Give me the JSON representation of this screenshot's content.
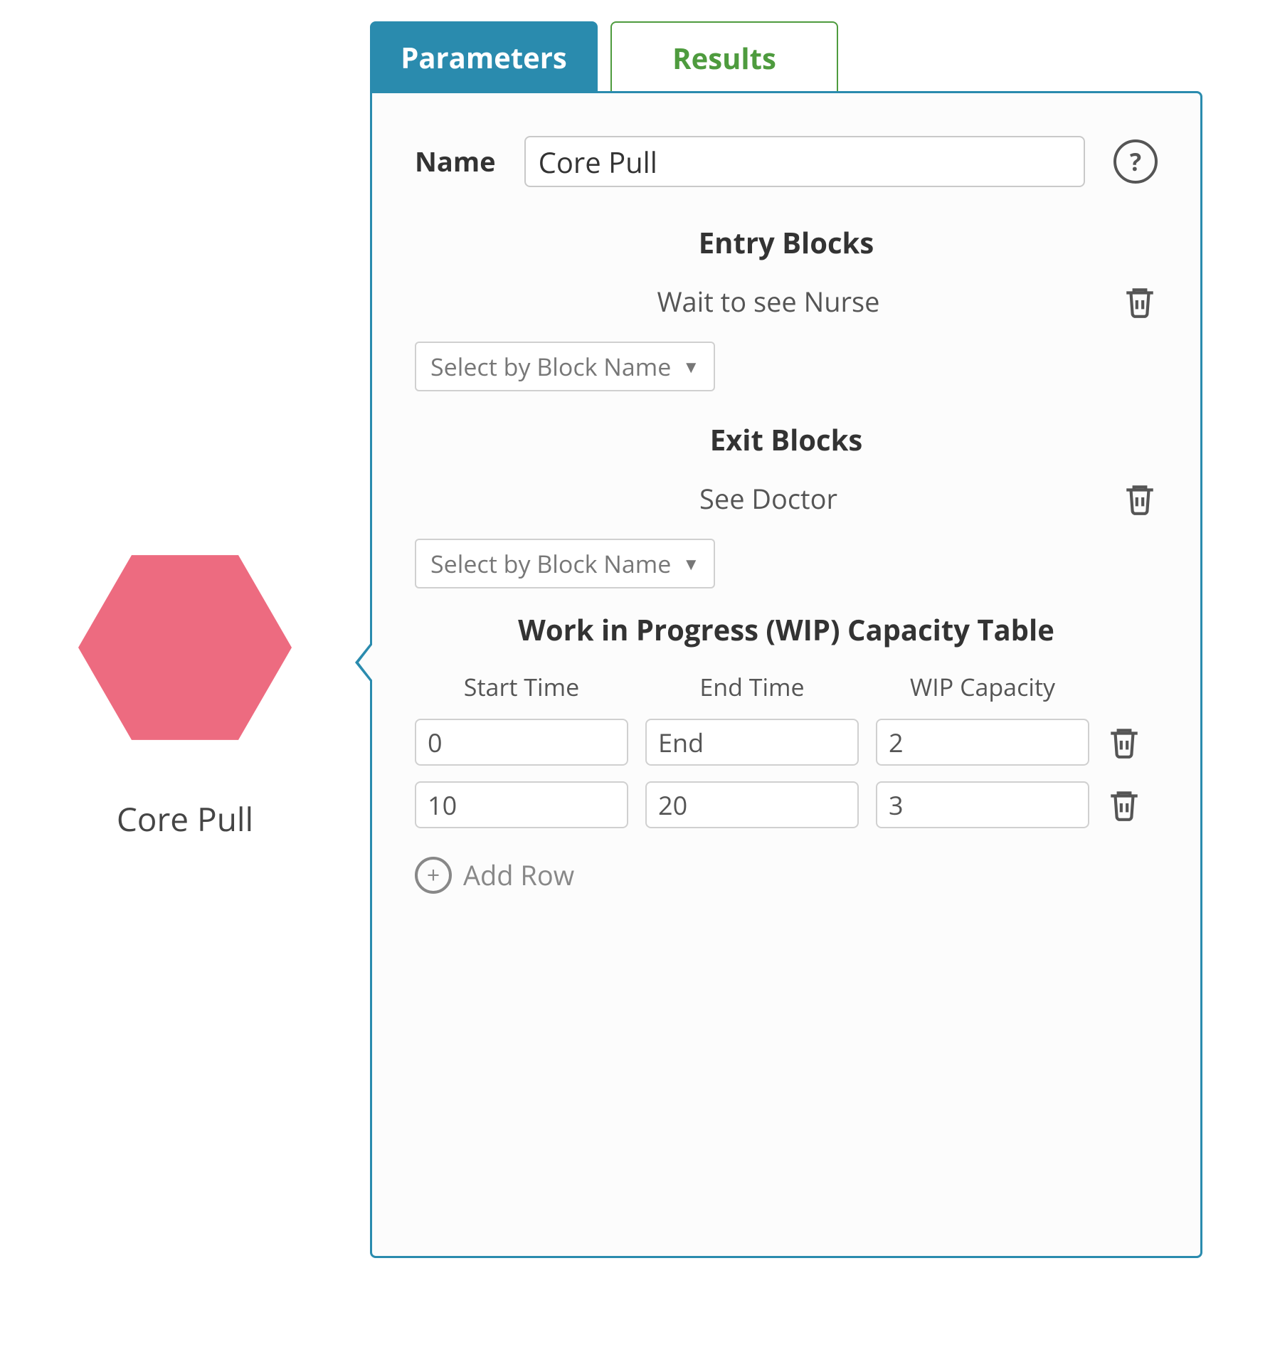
{
  "node": {
    "label": "Core Pull"
  },
  "tabs": {
    "parameters": "Parameters",
    "results": "Results"
  },
  "panel": {
    "name_label": "Name",
    "name_value": "Core Pull",
    "entry_blocks_title": "Entry Blocks",
    "entry_blocks": [
      {
        "label": "Wait to see Nurse"
      }
    ],
    "exit_blocks_title": "Exit Blocks",
    "exit_blocks": [
      {
        "label": "See Doctor"
      }
    ],
    "select_placeholder": "Select by Block Name",
    "wip": {
      "title": "Work in Progress (WIP) Capacity Table",
      "cols": {
        "start": "Start Time",
        "end": "End Time",
        "cap": "WIP Capacity"
      },
      "rows": [
        {
          "start": "0",
          "end": "End",
          "cap": "2"
        },
        {
          "start": "10",
          "end": "20",
          "cap": "3"
        }
      ],
      "add_row_label": "Add Row"
    }
  }
}
